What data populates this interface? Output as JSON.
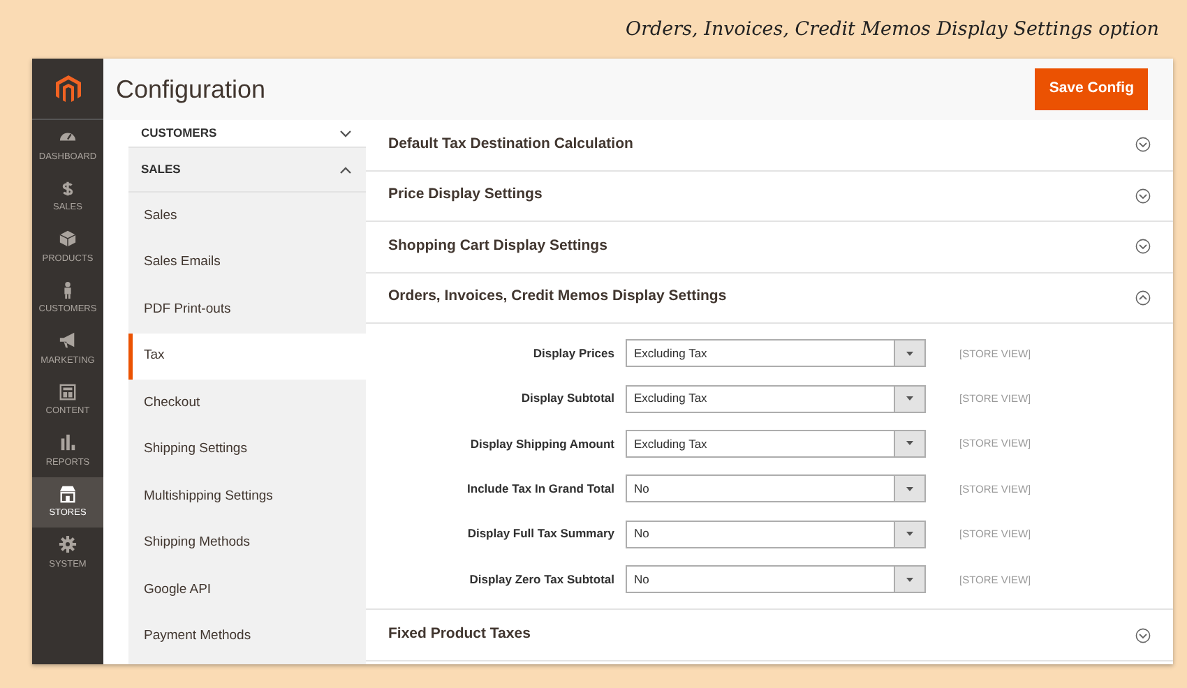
{
  "caption": "Orders, Invoices, Credit Memos Display Settings option",
  "page_title": "Configuration",
  "save_button": "Save Config",
  "nav": [
    {
      "label": "DASHBOARD",
      "selected": false
    },
    {
      "label": "SALES",
      "selected": false
    },
    {
      "label": "PRODUCTS",
      "selected": false
    },
    {
      "label": "CUSTOMERS",
      "selected": false
    },
    {
      "label": "MARKETING",
      "selected": false
    },
    {
      "label": "CONTENT",
      "selected": false
    },
    {
      "label": "REPORTS",
      "selected": false
    },
    {
      "label": "STORES",
      "selected": true
    },
    {
      "label": "SYSTEM",
      "selected": false
    }
  ],
  "sidebar": [
    {
      "label": "CUSTOMERS",
      "expanded": false
    },
    {
      "label": "SALES",
      "expanded": true,
      "items": [
        {
          "label": "Sales",
          "selected": false
        },
        {
          "label": "Sales Emails",
          "selected": false
        },
        {
          "label": "PDF Print-outs",
          "selected": false
        },
        {
          "label": "Tax",
          "selected": true
        },
        {
          "label": "Checkout",
          "selected": false
        },
        {
          "label": "Shipping Settings",
          "selected": false
        },
        {
          "label": "Multishipping Settings",
          "selected": false
        },
        {
          "label": "Shipping Methods",
          "selected": false
        },
        {
          "label": "Google API",
          "selected": false
        },
        {
          "label": "Payment Methods",
          "selected": false
        }
      ]
    }
  ],
  "sections": [
    {
      "title": "Default Tax Destination Calculation",
      "expanded": false
    },
    {
      "title": "Price Display Settings",
      "expanded": false
    },
    {
      "title": "Shopping Cart Display Settings",
      "expanded": false
    },
    {
      "title": "Orders, Invoices, Credit Memos Display Settings",
      "expanded": true,
      "fields": [
        {
          "label": "Display Prices",
          "value": "Excluding Tax",
          "scope": "[STORE VIEW]"
        },
        {
          "label": "Display Subtotal",
          "value": "Excluding Tax",
          "scope": "[STORE VIEW]"
        },
        {
          "label": "Display Shipping Amount",
          "value": "Excluding Tax",
          "scope": "[STORE VIEW]"
        },
        {
          "label": "Include Tax In Grand Total",
          "value": "No",
          "scope": "[STORE VIEW]"
        },
        {
          "label": "Display Full Tax Summary",
          "value": "No",
          "scope": "[STORE VIEW]"
        },
        {
          "label": "Display Zero Tax Subtotal",
          "value": "No",
          "scope": "[STORE VIEW]"
        }
      ]
    },
    {
      "title": "Fixed Product Taxes",
      "expanded": false
    }
  ]
}
